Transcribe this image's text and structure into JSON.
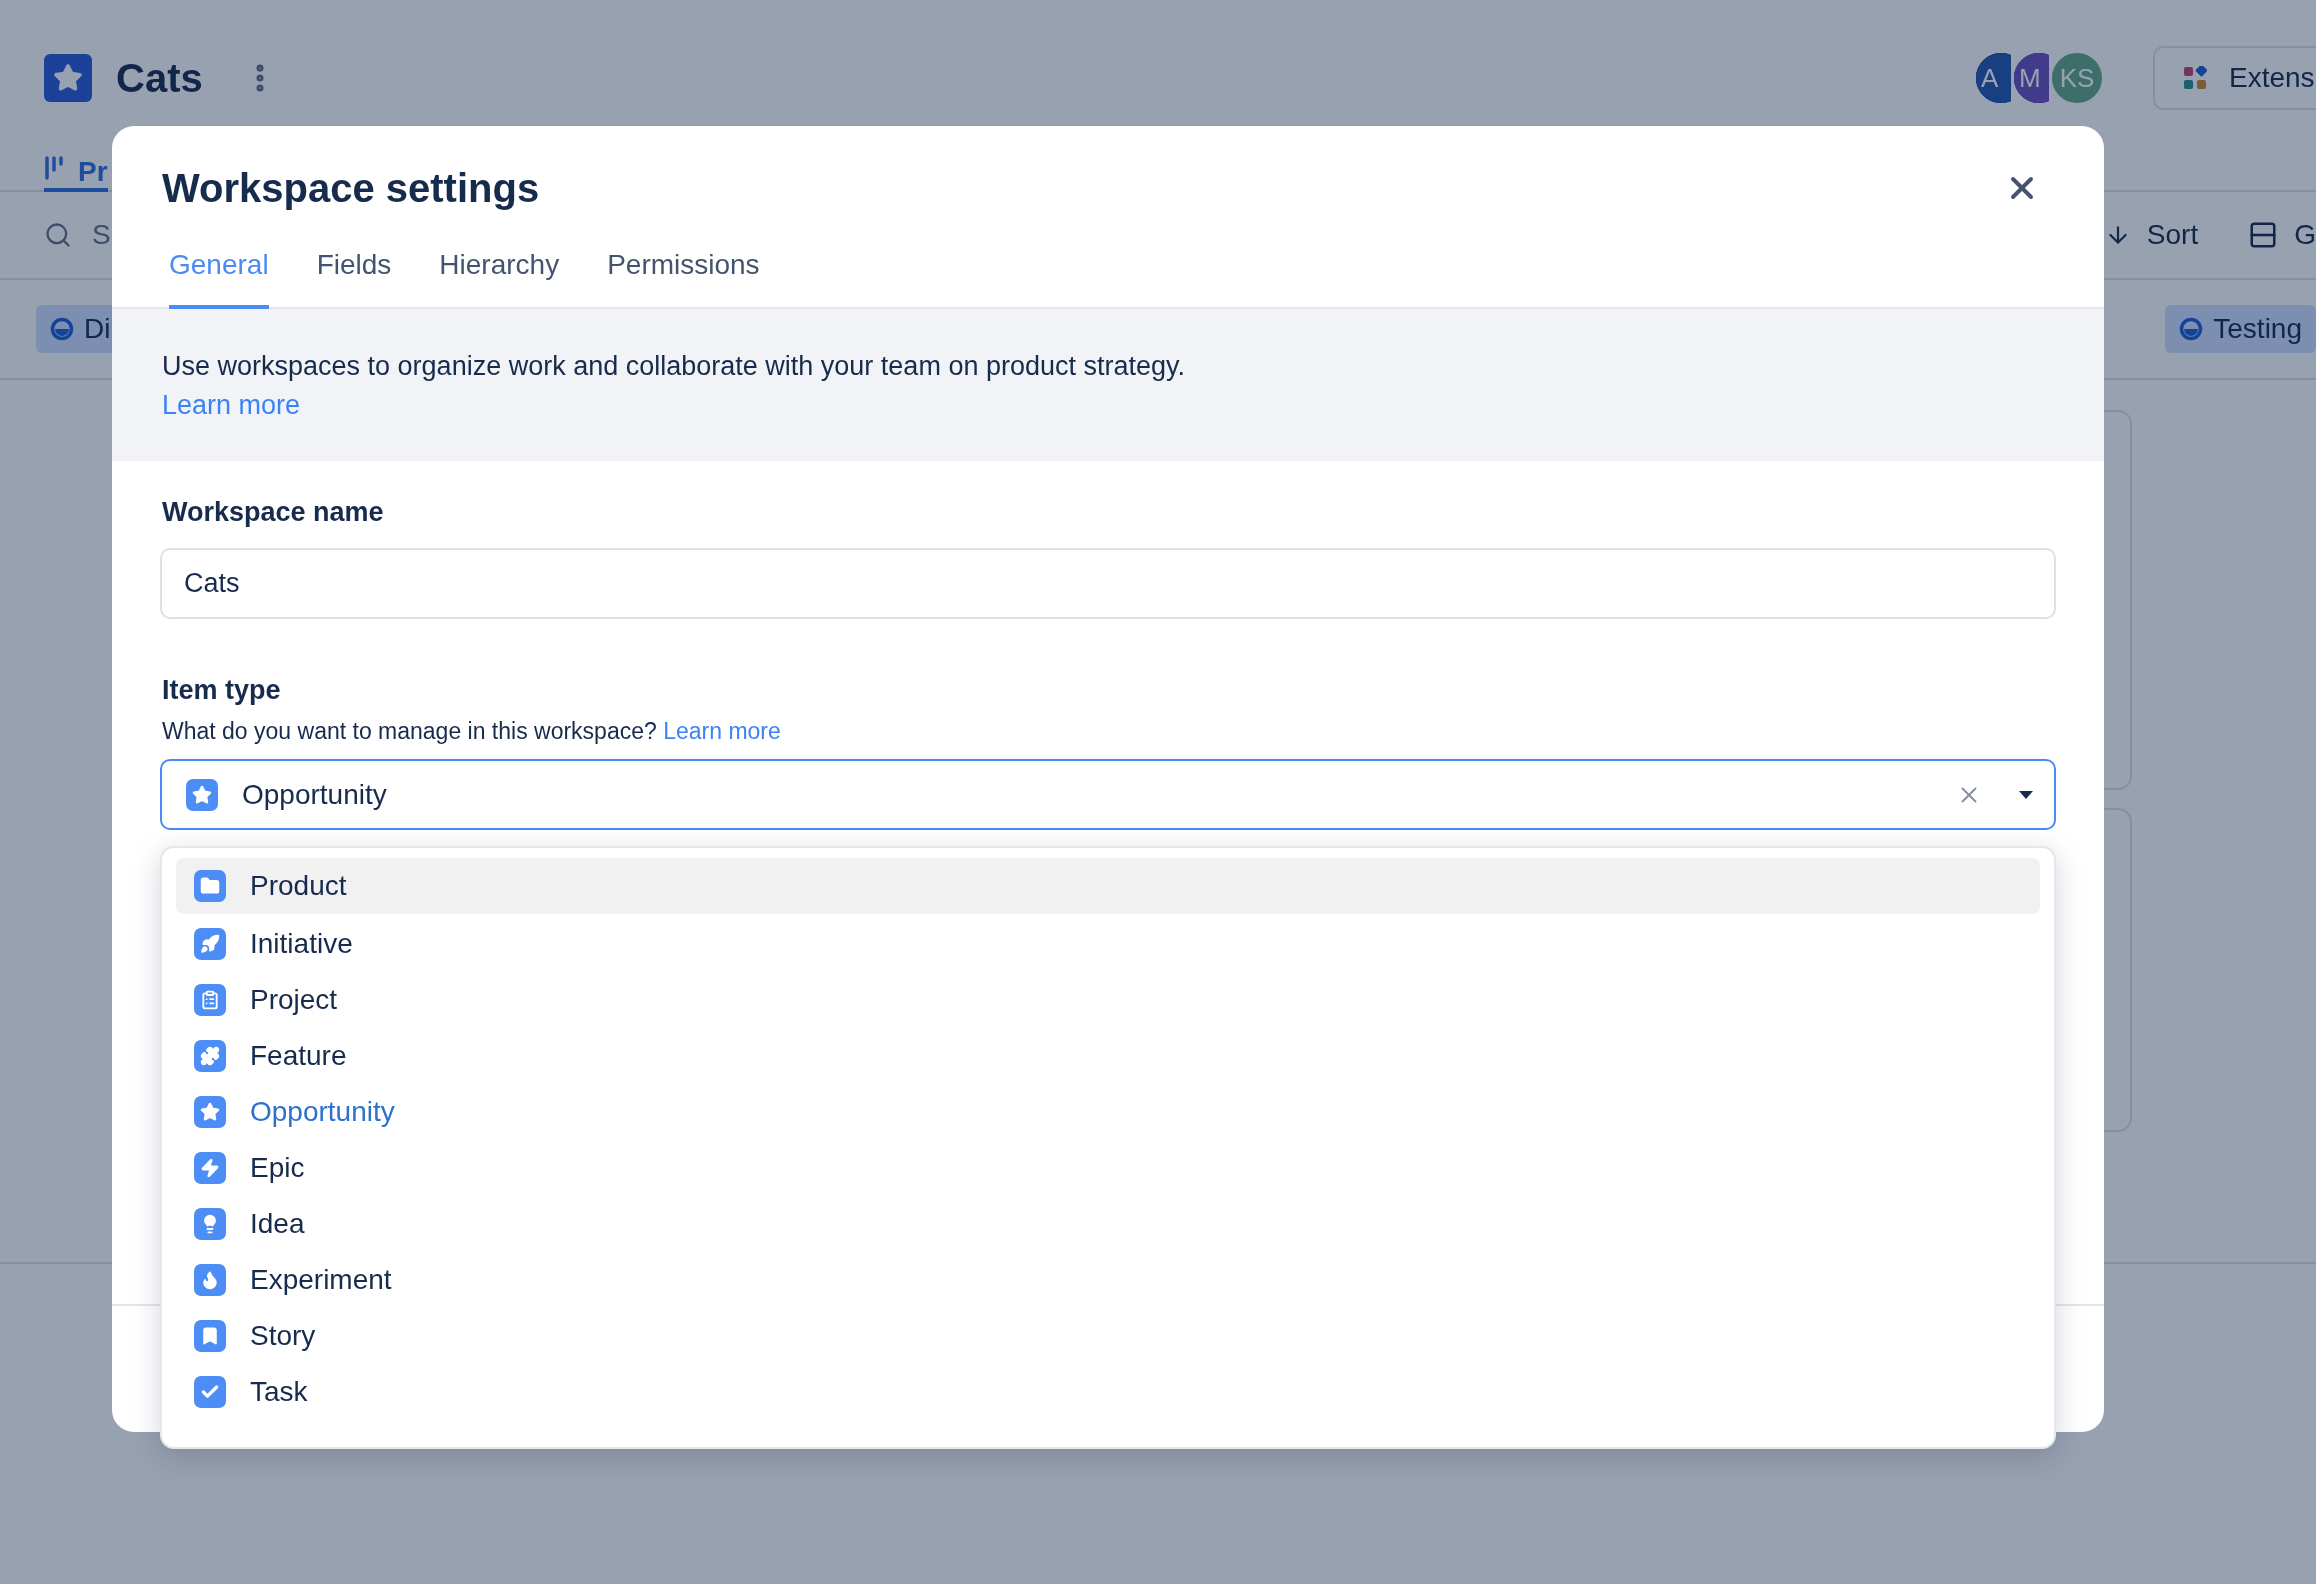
{
  "app": {
    "title": "Cats",
    "tabs": [
      {
        "label": "Pr",
        "selected": true
      }
    ],
    "search": {
      "placeholder": "S"
    },
    "avatars": [
      {
        "initials": "A"
      },
      {
        "initials": "M"
      },
      {
        "initials": "KS"
      }
    ],
    "extensions_button": "Extens",
    "toolbar": [
      "Sort",
      "G"
    ],
    "chips": [
      "Di",
      "Testing"
    ]
  },
  "modal": {
    "title": "Workspace settings",
    "tabs": [
      {
        "label": "General",
        "selected": true
      },
      {
        "label": "Fields",
        "selected": false
      },
      {
        "label": "Hierarchy",
        "selected": false
      },
      {
        "label": "Permissions",
        "selected": false
      }
    ],
    "info": {
      "text": "Use workspaces to organize work and collaborate with your team on product strategy.",
      "link": "Learn more"
    },
    "workspace_name": {
      "label": "Workspace name",
      "value": "Cats"
    },
    "item_type": {
      "label": "Item type",
      "help": "What do you want to manage in this workspace?",
      "help_link": "Learn more",
      "value": "Opportunity",
      "options": [
        {
          "label": "Product",
          "kind": "folder",
          "selected": false,
          "highlighted": true
        },
        {
          "label": "Initiative",
          "kind": "rocket",
          "selected": false,
          "highlighted": false
        },
        {
          "label": "Project",
          "kind": "clipboard",
          "selected": false,
          "highlighted": false
        },
        {
          "label": "Feature",
          "kind": "puzzle",
          "selected": false,
          "highlighted": false
        },
        {
          "label": "Opportunity",
          "kind": "star",
          "selected": true,
          "highlighted": false
        },
        {
          "label": "Epic",
          "kind": "bolt",
          "selected": false,
          "highlighted": false
        },
        {
          "label": "Idea",
          "kind": "bulb",
          "selected": false,
          "highlighted": false
        },
        {
          "label": "Experiment",
          "kind": "flame",
          "selected": false,
          "highlighted": false
        },
        {
          "label": "Story",
          "kind": "bookmark",
          "selected": false,
          "highlighted": false
        },
        {
          "label": "Task",
          "kind": "check",
          "selected": false,
          "highlighted": false
        }
      ]
    }
  }
}
